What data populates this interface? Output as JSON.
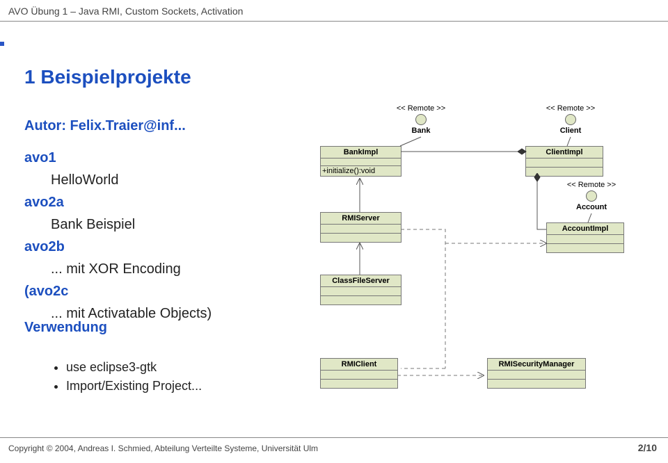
{
  "header": "AVO Übung 1 – Java RMI, Custom Sockets, Activation",
  "title": "1 Beispielprojekte",
  "author_label": "Autor: Felix.Traier@inf...",
  "items": {
    "avo1_key": "avo1",
    "avo1_sub": "HelloWorld",
    "avo2a_key": "avo2a",
    "avo2a_sub": "Bank Beispiel",
    "avo2b_key": "avo2b",
    "avo2b_sub": "... mit XOR Encoding",
    "avo2c_key": "(avo2c",
    "avo2c_sub": "... mit Activatable Objects)"
  },
  "usage_title": "Verwendung",
  "bullets": {
    "b1": "use eclipse3-gtk",
    "b2": "Import/Existing Project..."
  },
  "footer": "Copyright © 2004, Andreas I. Schmied, Abteilung Verteilte Systeme, Universität Ulm",
  "page": "2/10",
  "uml": {
    "remote_stereo": "<< Remote >>",
    "bank": "Bank",
    "client": "Client",
    "account": "Account",
    "bankimpl": "BankImpl",
    "bankimpl_method": "+initialize():void",
    "clientimpl": "ClientImpl",
    "accountimpl": "AccountImpl",
    "rmiserver": "RMIServer",
    "classfileserver": "ClassFileServer",
    "rmiclient": "RMIClient",
    "rmisecurity": "RMISecurityManager"
  },
  "chart_data": {
    "type": "table",
    "description": "UML class diagram",
    "interfaces": [
      {
        "name": "Bank",
        "stereotype": "<< Remote >>"
      },
      {
        "name": "Client",
        "stereotype": "<< Remote >>"
      },
      {
        "name": "Account",
        "stereotype": "<< Remote >>"
      }
    ],
    "classes": [
      {
        "name": "BankImpl",
        "methods": [
          "+initialize():void"
        ],
        "implements": [
          "Bank"
        ]
      },
      {
        "name": "ClientImpl",
        "implements": [
          "Client"
        ]
      },
      {
        "name": "AccountImpl",
        "implements": [
          "Account"
        ]
      },
      {
        "name": "RMIServer"
      },
      {
        "name": "ClassFileServer"
      },
      {
        "name": "RMIClient"
      },
      {
        "name": "RMISecurityManager"
      }
    ],
    "associations": [
      {
        "from": "BankImpl",
        "to": "ClientImpl",
        "type": "composition"
      },
      {
        "from": "ClientImpl",
        "to": "AccountImpl",
        "type": "composition"
      },
      {
        "from": "RMIServer",
        "to": "BankImpl",
        "type": "association-open-arrow"
      },
      {
        "from": "ClassFileServer",
        "to": "RMIServer",
        "type": "association-open-arrow"
      },
      {
        "from": "RMIServer",
        "to": "RMIClient",
        "type": "dependency-dashed"
      },
      {
        "from": "RMIClient",
        "to": "RMISecurityManager",
        "type": "dependency-dashed-arrow"
      },
      {
        "from": "RMIClient",
        "to": "AccountImpl",
        "type": "dependency-dashed"
      }
    ]
  }
}
